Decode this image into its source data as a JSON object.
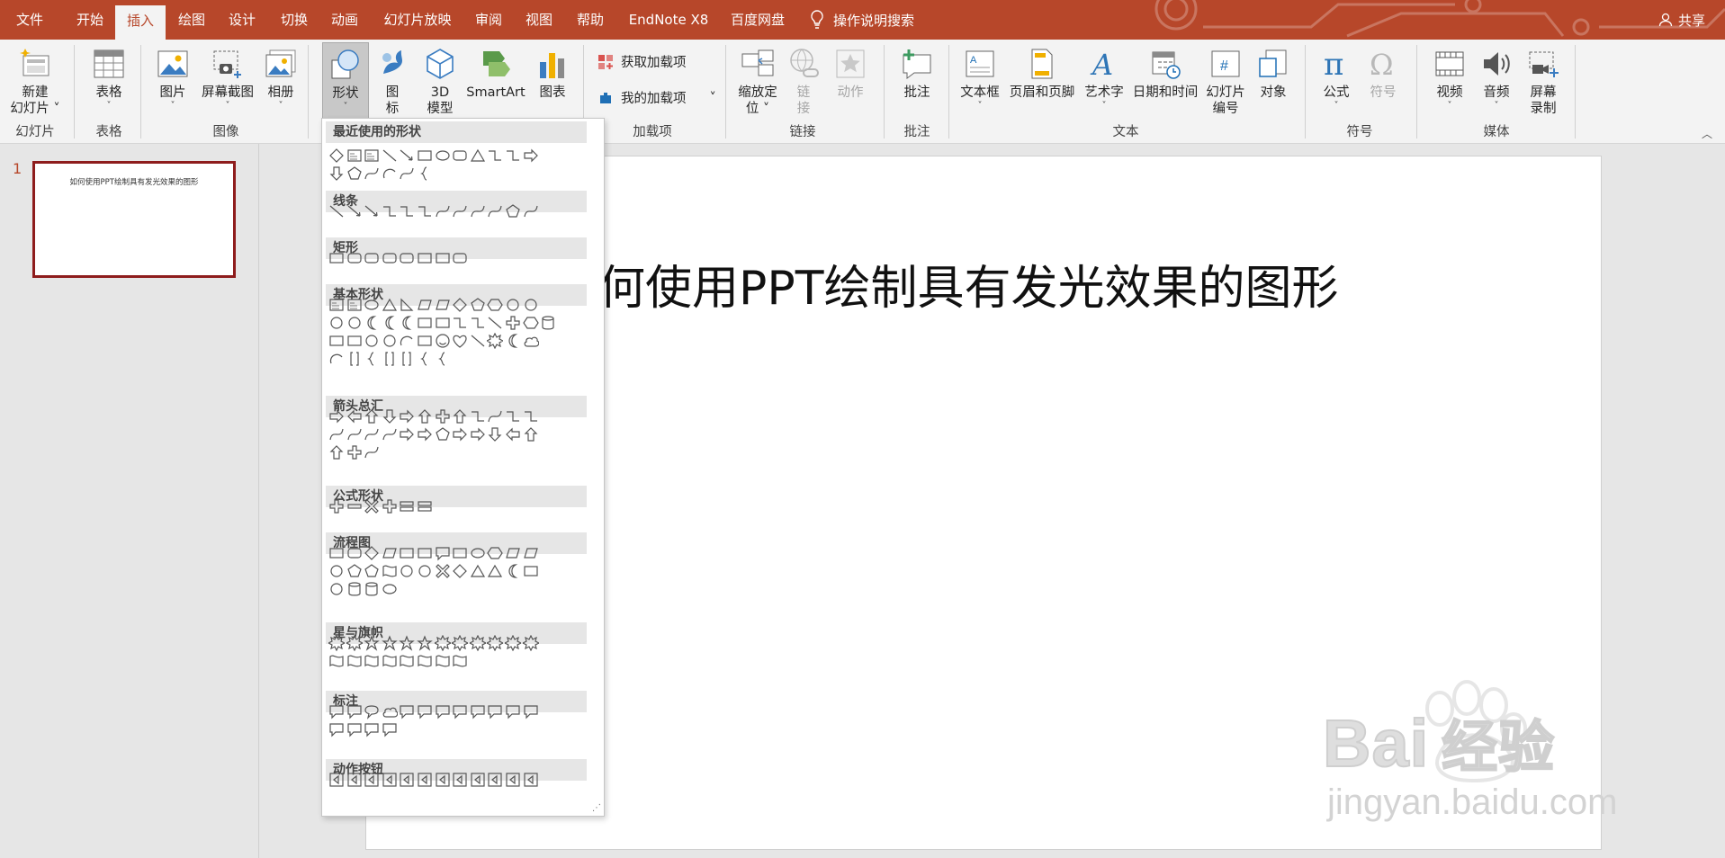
{
  "tabs": [
    "文件",
    "开始",
    "插入",
    "绘图",
    "设计",
    "切换",
    "动画",
    "幻灯片放映",
    "审阅",
    "视图",
    "帮助",
    "EndNote X8",
    "百度网盘"
  ],
  "active_tab": "插入",
  "tell_me": "操作说明搜索",
  "share": "共享",
  "ribbon": {
    "new_slide": {
      "line1": "新建",
      "line2": "幻灯片"
    },
    "table": "表格",
    "pictures": "图片",
    "screenshot": "屏幕截图",
    "album": "相册",
    "shapes": "形状",
    "icons": {
      "line1": "图",
      "line2": "标"
    },
    "model3d": {
      "line1": "3D",
      "line2": "模型"
    },
    "smartart": "SmartArt",
    "chart": "图表",
    "get_addins": "获取加载项",
    "my_addins": "我的加载项",
    "zoom": {
      "line1": "缩放定",
      "line2": "位"
    },
    "link": {
      "line1": "链",
      "line2": "接"
    },
    "action": "动作",
    "comment": "批注",
    "textbox": "文本框",
    "header_footer": "页眉和页脚",
    "wordart": "艺术字",
    "datetime": "日期和时间",
    "slide_number": {
      "line1": "幻灯片",
      "line2": "编号"
    },
    "object": "对象",
    "equation": "公式",
    "symbol": "符号",
    "video": "视频",
    "audio": "音频",
    "screen_rec": {
      "line1": "屏幕",
      "line2": "录制"
    },
    "groups": {
      "slides": "幻灯片",
      "tables": "表格",
      "images": "图像",
      "addins": "加载项",
      "links": "链接",
      "comments": "批注",
      "text": "文本",
      "symbols": "符号",
      "media": "媒体"
    }
  },
  "slide_number": "1",
  "slide_title": "如何使用PPT绘制具有发光效果的图形",
  "slide_title_visible": "何使用PPT绘制具有发光效果的图形",
  "shape_sections": {
    "recent": "最近使用的形状",
    "lines": "线条",
    "rect": "矩形",
    "basic": "基本形状",
    "arrows": "箭头总汇",
    "equation": "公式形状",
    "flowchart": "流程图",
    "stars": "星与旗帜",
    "callouts": "标注",
    "action": "动作按钮"
  },
  "watermark": {
    "brand": "Bai",
    "cn": "经验",
    "url": "jingyan.baidu.com"
  },
  "colors": {
    "accent": "#b7472a",
    "ribbon": "#f3f3f3",
    "thumb_border": "#8e1c1c"
  }
}
